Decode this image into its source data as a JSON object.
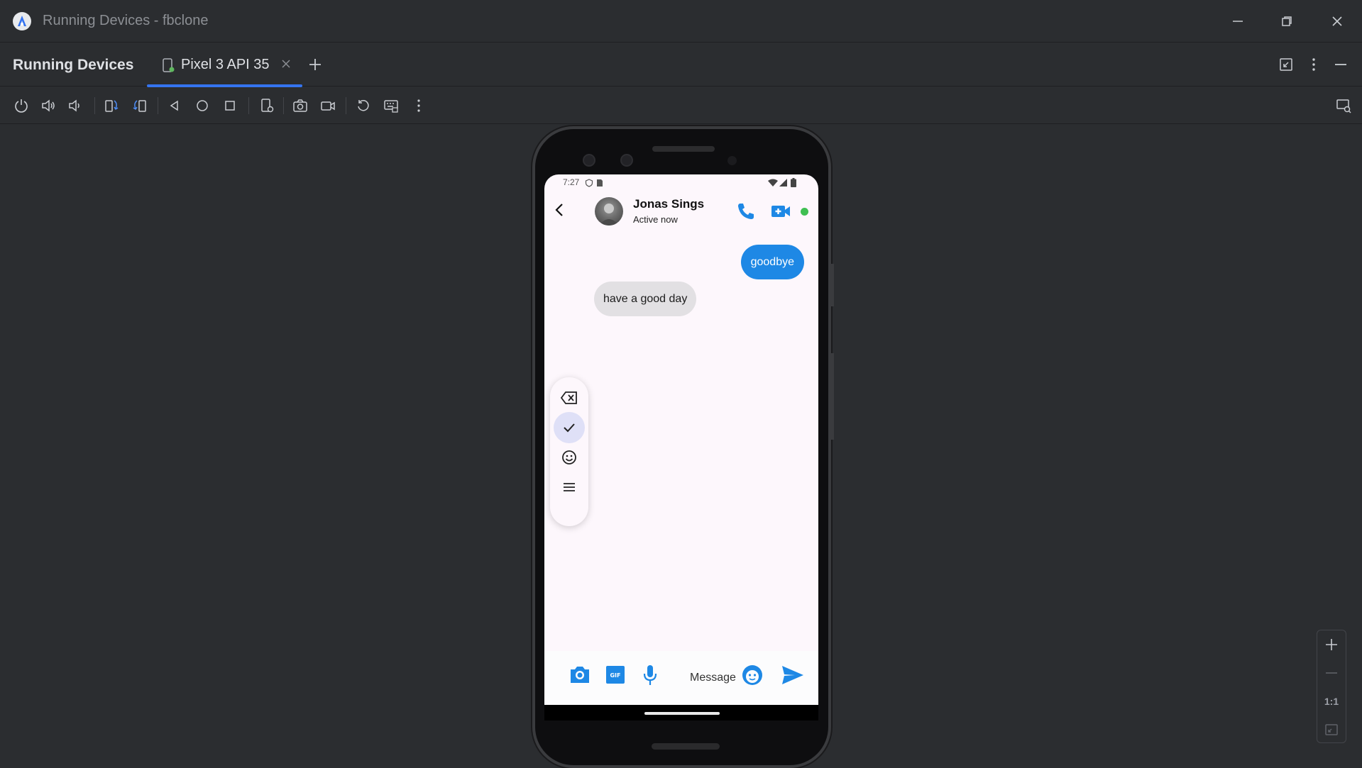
{
  "window": {
    "title": "Running Devices - fbclone",
    "icon": "android-studio-logo"
  },
  "panel": {
    "title": "Running Devices",
    "tabs": [
      {
        "label": "Pixel 3 API 35",
        "icon": "device-icon",
        "active": true
      }
    ]
  },
  "toolbar": {
    "actions": [
      "power",
      "volume-up",
      "volume-down",
      "rotate-left",
      "rotate-right",
      "back",
      "home",
      "overview",
      "device-settings",
      "screenshot",
      "screen-record",
      "reset",
      "keyboard-input",
      "more"
    ]
  },
  "device": {
    "status_time": "7:27",
    "chat": {
      "contact_name": "Jonas Sings",
      "contact_status": "Active now",
      "online_color": "#3fbf52",
      "messages": [
        {
          "direction": "outgoing",
          "text": "goodbye"
        },
        {
          "direction": "incoming",
          "text": "have a good day"
        }
      ],
      "input_placeholder": "Message"
    },
    "floating_toolbar": [
      "backspace",
      "check",
      "emoji",
      "menu"
    ]
  },
  "zoom": {
    "actual_size_label": "1:1"
  },
  "colors": {
    "accent": "#3574f0",
    "messenger_blue": "#1e88e5",
    "ide_background": "#2b2d30"
  }
}
